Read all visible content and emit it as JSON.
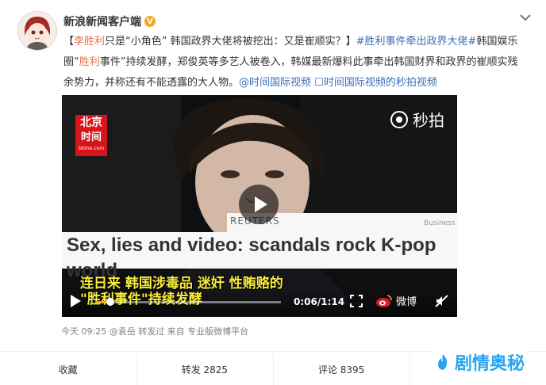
{
  "author": {
    "name": "新浪新闻客户端",
    "verified_glyph": "V"
  },
  "post": {
    "text": [
      {
        "t": "【",
        "style": "plain"
      },
      {
        "t": "李胜利",
        "style": "mention"
      },
      {
        "t": "只是“小角色” 韩国政界大佬将被挖出：又是崔顺实？】",
        "style": "plain"
      },
      {
        "t": "#胜利事件牵出政界大佬#",
        "style": "tag"
      },
      {
        "t": "韩国娱乐圈“",
        "style": "plain"
      },
      {
        "t": "胜利",
        "style": "mention"
      },
      {
        "t": "事件”持续发酵，郑俊英等多艺人被卷入，韩媒最新爆料此事牵出韩国财界和政界的崔顺实残余势力，并称还有不能透露的大人物。",
        "style": "plain"
      },
      {
        "t": "@时间国际视频",
        "style": "link"
      },
      {
        "t": " ",
        "style": "plain"
      },
      {
        "t": "☐时间国际视频的秒拍视频",
        "style": "link"
      }
    ]
  },
  "video": {
    "logo_line1": "北京",
    "logo_line2": "时间",
    "logo_line3": "btime.com",
    "miaopai_label": "秒拍",
    "reuters": "REUTERS",
    "business": "Business",
    "headline": "Sex, lies and video: scandals rock K-pop",
    "headline_cont": "world",
    "caption_line1": "连日来 韩国涉毒品 迷奸 性贿赂的",
    "caption_line2": "\"胜利事件\"持续发酵",
    "time": "0:06/1:14",
    "weibo_label": "微博",
    "progress": 0.08
  },
  "meta": {
    "text": "今天 09:25 @袁岳 转发过 来自 专业版微博平台"
  },
  "actions": [
    {
      "label": "收藏"
    },
    {
      "label": "转发 2825"
    },
    {
      "label": "评论 8395"
    },
    {
      "label": ""
    }
  ],
  "watermark": {
    "text": "剧情奥秘"
  },
  "colors": {
    "mention": "#eb7350",
    "link": "#3b6fb6",
    "caption": "#f8ec3c",
    "progress": "#f5a623"
  }
}
